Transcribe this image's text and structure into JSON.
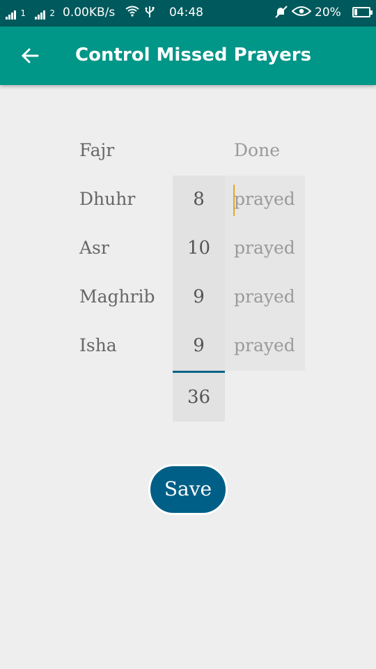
{
  "status_bar": {
    "sim1_label": "1",
    "sim2_label": "2",
    "network_speed": "0.00KB/s",
    "time": "04:48",
    "battery_percent": "20%",
    "battery_level": 0.2,
    "icons": [
      "signal-icon",
      "wifi-icon",
      "usb-icon",
      "mute-icon",
      "eye-icon",
      "battery-icon"
    ]
  },
  "app_bar": {
    "title": "Control Missed Prayers",
    "back_icon": "arrow-back-icon",
    "color": "#009688"
  },
  "table": {
    "done_header": "Done",
    "rows": [
      {
        "prayer": "Fajr",
        "count": "",
        "done_placeholder": ""
      },
      {
        "prayer": "Dhuhr",
        "count": "8",
        "done_placeholder": "prayed"
      },
      {
        "prayer": "Asr",
        "count": "10",
        "done_placeholder": "prayed"
      },
      {
        "prayer": "Maghrib",
        "count": "9",
        "done_placeholder": "prayed"
      },
      {
        "prayer": "Isha",
        "count": "9",
        "done_placeholder": "prayed"
      }
    ],
    "total": "36"
  },
  "save_button": {
    "label": "Save",
    "color": "#005f86"
  }
}
